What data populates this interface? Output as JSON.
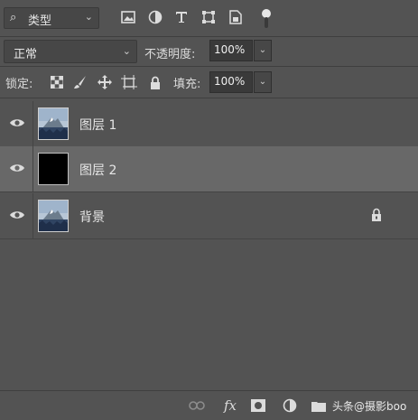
{
  "filter": {
    "kind_label": "类型",
    "icons": [
      "search-icon",
      "image-filter-icon",
      "adjustment-filter-icon",
      "type-filter-icon",
      "shape-filter-icon",
      "smart-object-filter-icon"
    ]
  },
  "blend": {
    "mode": "正常",
    "opacity_label": "不透明度:",
    "opacity_value": "100%"
  },
  "locks": {
    "label": "锁定:",
    "fill_label": "填充:",
    "fill_value": "100%"
  },
  "layers": [
    {
      "name": "图层 1",
      "visible": true,
      "thumb": "mountain",
      "selected": false
    },
    {
      "name": "图层 2",
      "visible": true,
      "thumb": "black",
      "selected": true
    },
    {
      "name": "背景",
      "visible": true,
      "thumb": "mountain",
      "selected": false,
      "locked": true
    }
  ],
  "bottom": {
    "fx_label": "fx",
    "watermark": "头条@摄影boo"
  }
}
